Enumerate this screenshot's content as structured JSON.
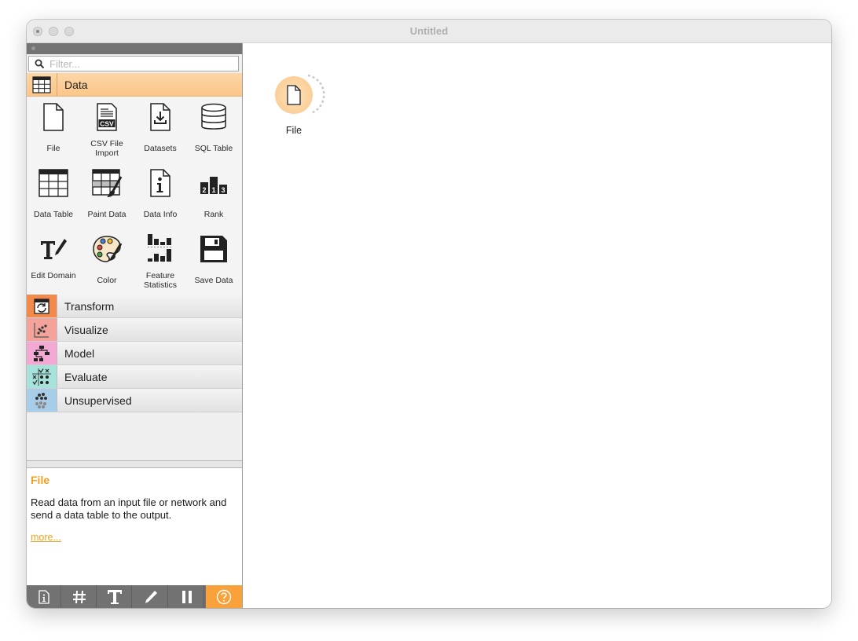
{
  "window": {
    "title": "Untitled"
  },
  "filter": {
    "placeholder": "Filter..."
  },
  "categories": {
    "data": {
      "label": "Data",
      "color": "#fbc68a"
    },
    "transform": {
      "label": "Transform",
      "color": "#f28a4b"
    },
    "visualize": {
      "label": "Visualize",
      "color": "#f4a39b"
    },
    "model": {
      "label": "Model",
      "color": "#f4a8d4"
    },
    "evaluate": {
      "label": "Evaluate",
      "color": "#a8e3db"
    },
    "unsupervised": {
      "label": "Unsupervised",
      "color": "#a8cde8"
    }
  },
  "widgets": [
    {
      "name": "file",
      "label": "File"
    },
    {
      "name": "csv-file-import",
      "label": "CSV File Import"
    },
    {
      "name": "datasets",
      "label": "Datasets"
    },
    {
      "name": "sql-table",
      "label": "SQL Table"
    },
    {
      "name": "data-table",
      "label": "Data Table"
    },
    {
      "name": "paint-data",
      "label": "Paint Data"
    },
    {
      "name": "data-info",
      "label": "Data Info"
    },
    {
      "name": "rank",
      "label": "Rank"
    },
    {
      "name": "edit-domain",
      "label": "Edit Domain"
    },
    {
      "name": "color",
      "label": "Color"
    },
    {
      "name": "feature-statistics",
      "label": "Feature Statistics"
    },
    {
      "name": "save-data",
      "label": "Save Data"
    }
  ],
  "rank_icon_digits": [
    "2",
    "1",
    "3"
  ],
  "csv_icon_text": "CSV",
  "help": {
    "title": "File",
    "description": "Read data from an input file or network and send a data table to the output.",
    "more": "more..."
  },
  "toolbar": {
    "items": [
      "info-icon",
      "grid-icon",
      "text-icon",
      "pencil-icon",
      "pause-icon",
      "help-icon"
    ],
    "active": "help-icon",
    "active_color": "#f9a13a"
  },
  "canvas": {
    "nodes": [
      {
        "label": "File",
        "icon": "file-icon"
      }
    ]
  },
  "colors": {
    "accent": "#f0a020",
    "node_fill": "#fbcf98"
  }
}
